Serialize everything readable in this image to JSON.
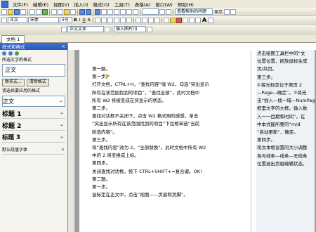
{
  "menubar": {
    "items": [
      "文件(F)",
      "编辑(E)",
      "视图(V)",
      "插入(I)",
      "格式(O)",
      "工具(T)",
      "表格(A)",
      "窗口(W)",
      "帮助(H)"
    ]
  },
  "toolbar": {
    "style_combo": "正文",
    "font_combo": "宋体",
    "size_combo": "5号",
    "bold": "B",
    "italic": "I",
    "underline": "U",
    "font_a": "A",
    "search_combo": "查看帮助的问题",
    "show_label": "显示",
    "para_combo": "正文文本",
    "area_combo": "插入图片(I)",
    "big_a": "A"
  },
  "tabs": {
    "doc_tab": "文档 1"
  },
  "sidepane": {
    "title": "样式和格式",
    "close": "×",
    "current_label": "所选文字的格式",
    "current_style": "正文",
    "new_btn": "新样式...",
    "clear_btn": "清除格式",
    "apply_label": "请选择要应用的格式",
    "styles": [
      {
        "name": "正文",
        "mark": "↵"
      },
      {
        "name": "标题 1",
        "mark": "↵"
      },
      {
        "name": "标题 2",
        "mark": "↵"
      },
      {
        "name": "标题 3",
        "mark": "↵"
      },
      {
        "name": "默认段落字体",
        "mark": "a"
      }
    ]
  },
  "document": {
    "left_lines": [
      "第一题。",
      "第一步。",
      "打开文档，CTRL+H，“查找内容”填 W2，勾选“突出显示",
      "所有在该范围找到的项目”，“查找全部”，此时文档中",
      "所有 W2 将被变成在突显示的状态。",
      "第二步。",
      "查找对话框不关闭下，点击 W2 格式刷的感想，单击",
      "“突出显示所有在该范围找到的项目”下拉框单选“当前",
      "所选内容”。",
      "第三步。",
      "将“查找内容”改为 2，“全部替换”。此时文档中所有 W2",
      "中的 2 将变换成上标。",
      "第四步。",
      "关闭查找对话框，按下 CTRL+SHIFT+=复合键。OK！",
      "",
      "第二题。",
      "第一步。",
      "鼠标定在正文中，点击“视图——页眉和页脚”。"
    ],
    "right_lines": [
      "点击绘图工具栏中的“文",
      "位置位置，拖放鼠标生成",
      "页/共页。",
      "第三步。",
      "①将光标定位于第页 2",
      "—Page—确定”。②将光",
      "击“插入—插一域—NumPages",
      "框里文字的大框。输入数",
      "入一一目期和时间”，在",
      "中本式能所要的“m/d",
      "“自动更新”，确定。",
      "第四步。",
      "将文本框设置的大小调整",
      "色与线条—线条—无线条",
      "位置退出页眉编辑状态。"
    ]
  }
}
